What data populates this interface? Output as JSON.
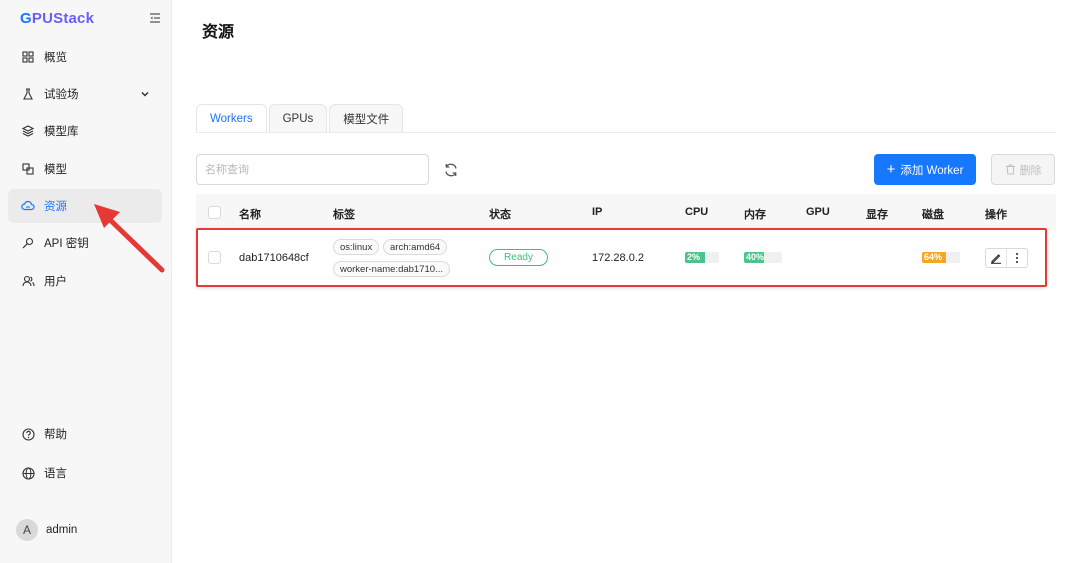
{
  "app": {
    "logo_first": "G",
    "logo_rest": "PUStack"
  },
  "sidebar": {
    "items": [
      {
        "label": "概览",
        "icon": "dashboard-icon"
      },
      {
        "label": "试验场",
        "icon": "flask-icon"
      },
      {
        "label": "模型库",
        "icon": "layers-icon"
      },
      {
        "label": "模型",
        "icon": "model-icon"
      },
      {
        "label": "资源",
        "icon": "cloud-icon",
        "active": true
      },
      {
        "label": "API 密钥",
        "icon": "key-icon"
      },
      {
        "label": "用户",
        "icon": "users-icon"
      }
    ],
    "help_label": "帮助",
    "language_label": "语言",
    "user": {
      "avatar_letter": "A",
      "name": "admin"
    }
  },
  "page": {
    "title": "资源"
  },
  "tabs": [
    {
      "label": "Workers",
      "active": true
    },
    {
      "label": "GPUs"
    },
    {
      "label": "模型文件"
    }
  ],
  "toolbar": {
    "search_placeholder": "名称查询",
    "add_label": "添加 Worker",
    "delete_label": "删除"
  },
  "table": {
    "columns": [
      "名称",
      "标签",
      "状态",
      "IP",
      "CPU",
      "内存",
      "GPU",
      "显存",
      "磁盘",
      "操作"
    ],
    "rows": [
      {
        "name": "dab1710648cf",
        "tags": [
          "os:linux",
          "arch:amd64",
          "worker-name:dab1710..."
        ],
        "status": "Ready",
        "ip": "172.28.0.2",
        "cpu": {
          "label": "2%",
          "value": 2
        },
        "memory": {
          "label": "40%",
          "value": 40
        },
        "disk": {
          "label": "64%",
          "value": 64
        }
      }
    ]
  },
  "colors": {
    "accent": "#1677ff",
    "success": "#3cbf7a",
    "cpu_bar": "#4cc38a",
    "disk_bar": "#f5a623",
    "annotation": "#e53935"
  }
}
